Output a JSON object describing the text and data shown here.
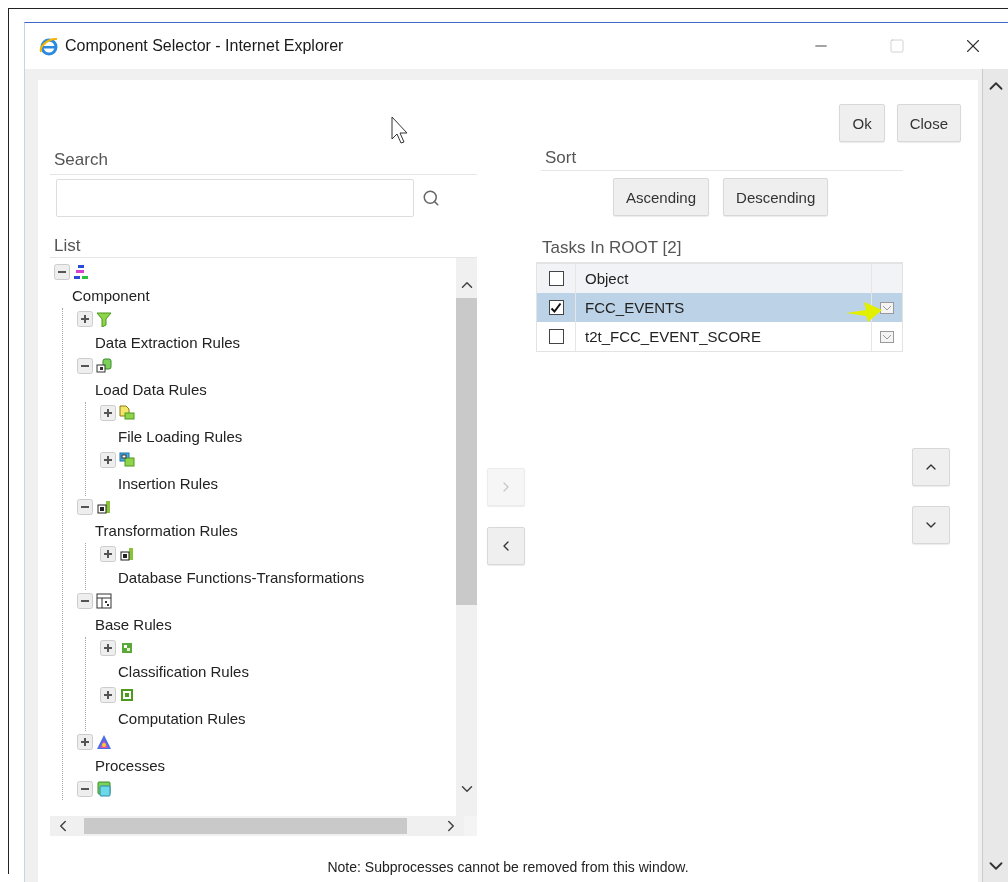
{
  "window": {
    "title": "Component Selector - Internet Explorer"
  },
  "dialog_buttons": [
    "Ok",
    "Close"
  ],
  "search": {
    "heading": "Search"
  },
  "list": {
    "heading": "List",
    "tree": [
      {
        "kind": "hierarchy",
        "label": "Component",
        "expanded": true,
        "children": [
          {
            "kind": "filter",
            "label": "Data Extraction Rules",
            "expanded": false
          },
          {
            "kind": "load",
            "label": "Load Data Rules",
            "expanded": true,
            "children": [
              {
                "kind": "file",
                "label": "File Loading Rules",
                "expanded": false
              },
              {
                "kind": "insert",
                "label": "Insertion Rules",
                "expanded": false
              }
            ]
          },
          {
            "kind": "transform",
            "label": "Transformation Rules",
            "expanded": true,
            "children": [
              {
                "kind": "transform",
                "label": "Database Functions-Transformations",
                "expanded": false
              }
            ]
          },
          {
            "kind": "base",
            "label": "Base Rules",
            "expanded": true,
            "children": [
              {
                "kind": "classify",
                "label": "Classification Rules",
                "expanded": false
              },
              {
                "kind": "compute",
                "label": "Computation Rules",
                "expanded": false
              }
            ]
          },
          {
            "kind": "process",
            "label": "Processes",
            "expanded": false
          },
          {
            "kind": "subprocess",
            "expanded": true
          }
        ]
      }
    ]
  },
  "sort": {
    "heading": "Sort",
    "buttons": [
      "Ascending",
      "Descending"
    ]
  },
  "tasks": {
    "heading": "Tasks In ROOT [2]",
    "header_checked": false,
    "columns": [
      "Object"
    ],
    "rows": [
      {
        "object": "FCC_EVENTS",
        "checked": true,
        "selected": true
      },
      {
        "object": "t2t_FCC_EVENT_SCORE",
        "checked": false,
        "selected": false
      }
    ]
  },
  "transfer_buttons": [
    {
      "kind": "right",
      "disabled": true
    },
    {
      "kind": "left",
      "disabled": false
    }
  ],
  "order_buttons": [
    {
      "kind": "up",
      "disabled": false
    },
    {
      "kind": "down",
      "disabled": false
    }
  ],
  "note": "Note: Subprocesses cannot be removed from this window."
}
